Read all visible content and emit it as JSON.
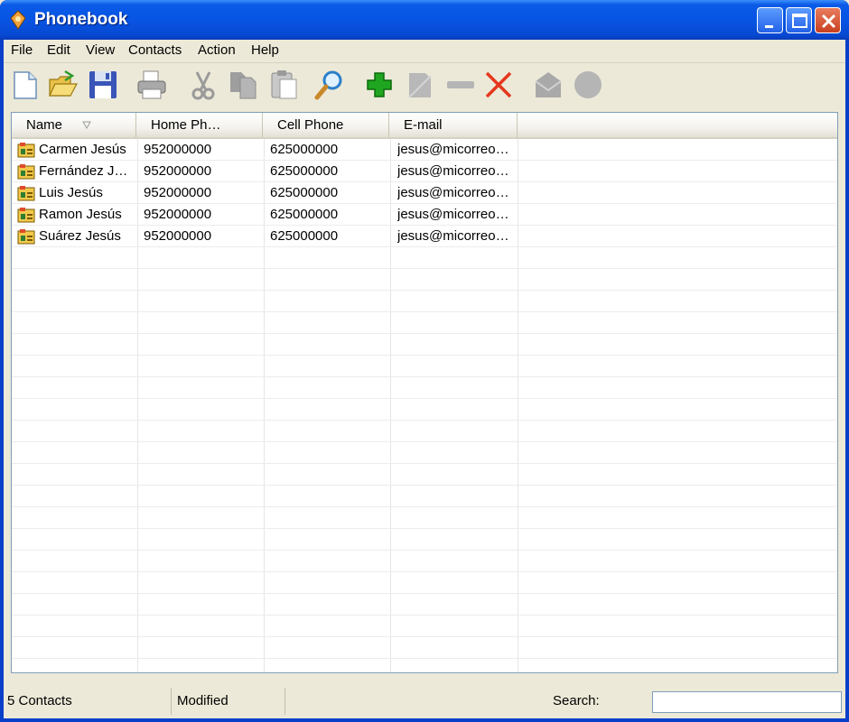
{
  "window": {
    "title": "Phonebook"
  },
  "menu": [
    "File",
    "Edit",
    "View",
    "Contacts",
    "Action",
    "Help"
  ],
  "toolbar": [
    {
      "name": "new-document-icon"
    },
    {
      "name": "open-folder-icon"
    },
    {
      "name": "save-disk-icon"
    },
    {
      "name": "print-icon"
    },
    {
      "name": "cut-scissors-icon"
    },
    {
      "name": "copy-icon"
    },
    {
      "name": "paste-icon"
    },
    {
      "name": "search-magnifier-icon"
    },
    {
      "name": "add-plus-icon"
    },
    {
      "name": "edit-contact-icon"
    },
    {
      "name": "remove-minus-icon"
    },
    {
      "name": "delete-x-icon"
    },
    {
      "name": "send-mail-icon"
    },
    {
      "name": "call-icon"
    }
  ],
  "columns": [
    "Name",
    "Home Ph…",
    "Cell Phone",
    "E-mail"
  ],
  "contacts": [
    {
      "name": "Carmen Jesús",
      "home": "952000000",
      "cell": "625000000",
      "email": "jesus@micorreo…"
    },
    {
      "name": "Fernández J…",
      "home": "952000000",
      "cell": "625000000",
      "email": "jesus@micorreo…"
    },
    {
      "name": "Luis Jesús",
      "home": "952000000",
      "cell": "625000000",
      "email": "jesus@micorreo…"
    },
    {
      "name": "Ramon Jesús",
      "home": "952000000",
      "cell": "625000000",
      "email": "jesus@micorreo…"
    },
    {
      "name": "Suárez Jesús",
      "home": "952000000",
      "cell": "625000000",
      "email": "jesus@micorreo…"
    }
  ],
  "status": {
    "count": "5 Contacts",
    "state": "Modified",
    "search_label": "Search:",
    "search_value": ""
  },
  "colors": {
    "titlebar": "#0854e3",
    "face": "#ece9d8",
    "add": "#1fa51f",
    "delete": "#e5371d"
  }
}
